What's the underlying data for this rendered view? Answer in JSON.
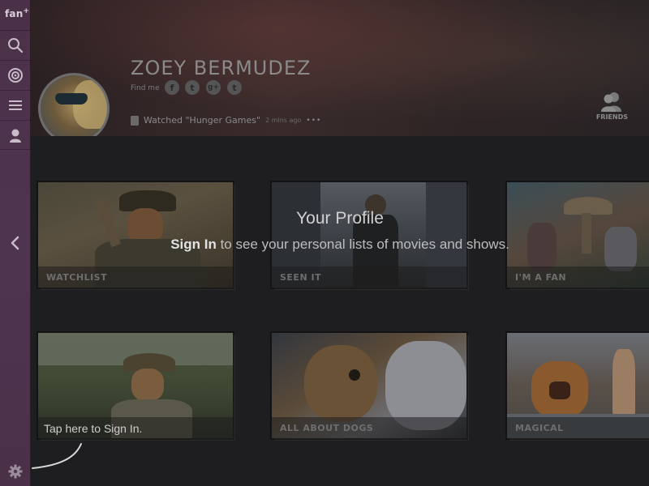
{
  "app": {
    "logo": "fan",
    "logo_mark": "+"
  },
  "sidebar": {
    "items": [
      {
        "name": "search",
        "icon": "search-icon"
      },
      {
        "name": "target",
        "icon": "target-icon"
      },
      {
        "name": "menu",
        "icon": "list-icon"
      },
      {
        "name": "profile",
        "icon": "person-icon"
      }
    ],
    "back_icon": "chevron-left-icon",
    "settings_icon": "gear-icon"
  },
  "profile": {
    "name": "ZOEY BERMUDEZ",
    "find_me_label": "Find me",
    "social": [
      {
        "name": "facebook",
        "glyph": "f"
      },
      {
        "name": "twitter",
        "glyph": "t"
      },
      {
        "name": "google-plus",
        "glyph": "g+"
      },
      {
        "name": "tumblr",
        "glyph": "t"
      }
    ],
    "activity_text": "Watched \"Hunger Games\"",
    "activity_time": "2 mins ago",
    "activity_more": "•••",
    "friends_label": "FRIENDS"
  },
  "lists": [
    {
      "label": "WATCHLIST"
    },
    {
      "label": "SEEN IT"
    },
    {
      "label": "I'M A FAN"
    },
    {
      "label": ""
    },
    {
      "label": "ALL ABOUT DOGS"
    },
    {
      "label": "MAGICAL"
    }
  ],
  "overlay": {
    "title": "Your Profile",
    "sign_in": "Sign In",
    "subtitle_rest": " to see your personal lists of movies and shows.",
    "tap_hint": "Tap here to Sign In."
  },
  "colors": {
    "sidebar": "#4f3450",
    "background": "#1b1a1c",
    "overlay_text": "#d0d0d0"
  }
}
